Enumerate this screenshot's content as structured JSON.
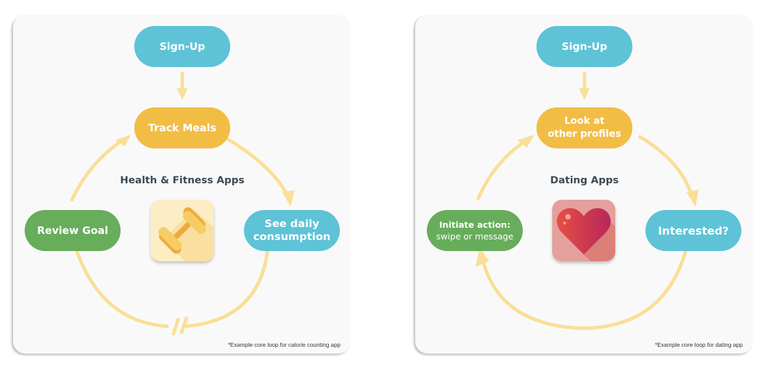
{
  "colors": {
    "signup": "#5ec3d7",
    "step_main": "#f2bd45",
    "step_action": "#67ad5b",
    "step_result": "#5ec3d7",
    "arrow": "#f9df97",
    "title_text": "#3d4a55"
  },
  "panels": [
    {
      "title": "Health & Fitness Apps",
      "icon": "dumbbell-icon",
      "nodes": {
        "signup": "Sign-Up",
        "top": "Track Meals",
        "right_line1": "See daily",
        "right_line2": "consumption",
        "left_line1": "Review Goal",
        "left_line2": ""
      },
      "bottom_arc": "broken (//)",
      "footnote": "*Example core loop for calorie counting app"
    },
    {
      "title": "Dating Apps",
      "icon": "heart-icon",
      "nodes": {
        "signup": "Sign-Up",
        "top_line1": "Look at",
        "top_line2": "other profiles",
        "right": "Interested?",
        "left_line1": "Initiate action:",
        "left_line2": "swipe or message"
      },
      "bottom_arc": "continuous with arrow",
      "footnote": "*Example core loop for dating app"
    }
  ]
}
